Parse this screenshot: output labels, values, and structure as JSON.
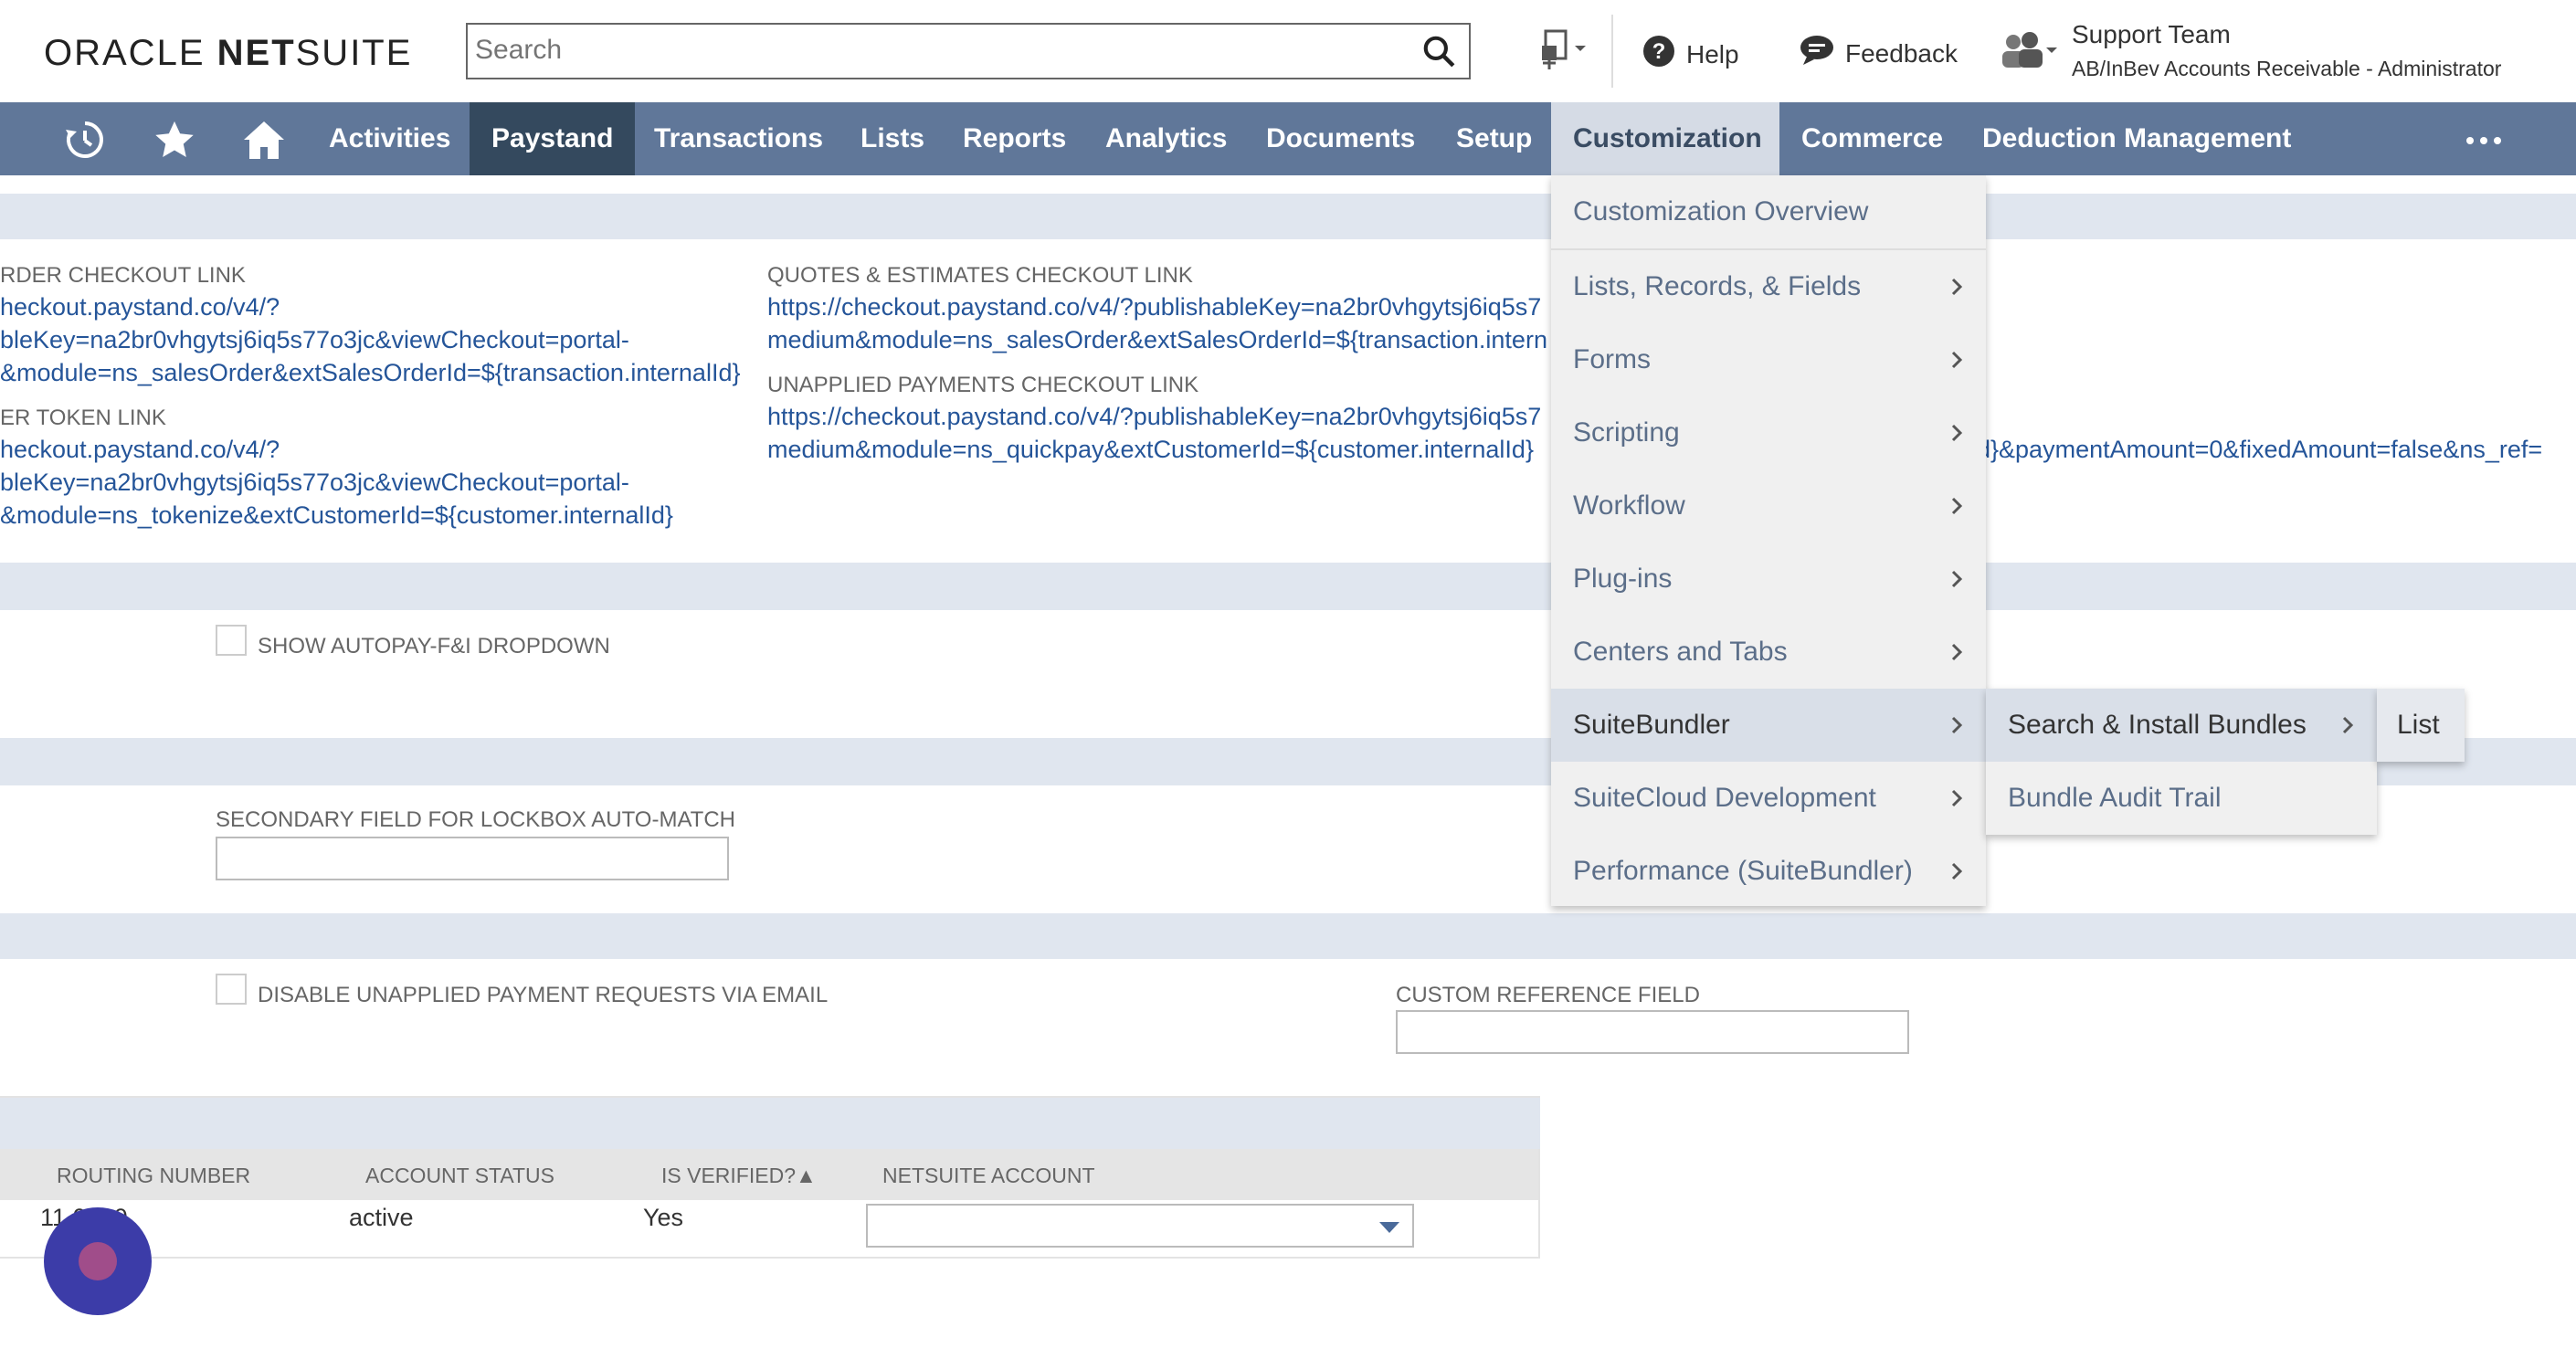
{
  "header": {
    "logo_oracle": "ORACLE",
    "logo_netsuite_bold": "NET",
    "logo_netsuite_rest": "SUITE",
    "search_placeholder": "Search",
    "help": "Help",
    "feedback": "Feedback",
    "role_name": "Support Team",
    "role_subtitle": "AB/InBev Accounts Receivable  -  Administrator"
  },
  "nav": {
    "items": [
      "Activities",
      "Paystand",
      "Transactions",
      "Lists",
      "Reports",
      "Analytics",
      "Documents",
      "Setup",
      "Customization",
      "Commerce",
      "Deduction Management"
    ]
  },
  "content": {
    "order_checkout_label": "RDER CHECKOUT LINK",
    "order_checkout_lines": [
      "heckout.paystand.co/v4/?",
      "bleKey=na2br0vhgytsj6iq5s77o3jc&viewCheckout=portal-",
      "&module=ns_salesOrder&extSalesOrderId=${transaction.internalId}"
    ],
    "token_label": "ER TOKEN LINK",
    "token_lines": [
      "heckout.paystand.co/v4/?",
      "bleKey=na2br0vhgytsj6iq5s77o3jc&viewCheckout=portal-",
      "&module=ns_tokenize&extCustomerId=${customer.internalId}"
    ],
    "quotes_label": "QUOTES & ESTIMATES CHECKOUT LINK",
    "quotes_lines": [
      "https://checkout.paystand.co/v4/?publishableKey=na2br0vhgytsj6iq5s7",
      "medium&module=ns_salesOrder&extSalesOrderId=${transaction.intern"
    ],
    "unapplied_label": "UNAPPLIED PAYMENTS CHECKOUT LINK",
    "unapplied_lines": [
      "https://checkout.paystand.co/v4/?publishableKey=na2br0vhgytsj6iq5s7",
      "medium&module=ns_quickpay&extCustomerId=${customer.internalId}"
    ],
    "unapplied_overflow": "d}&paymentAmount=0&fixedAmount=false&ns_ref=",
    "autopay_label": "SHOW AUTOPAY-F&I DROPDOWN",
    "lockbox_label": "SECONDARY FIELD FOR LOCKBOX AUTO-MATCH",
    "disable_label": "DISABLE UNAPPLIED PAYMENT REQUESTS VIA EMAIL",
    "custom_ref_label": "CUSTOM REFERENCE FIELD"
  },
  "table": {
    "headers": [
      "ROUTING NUMBER",
      "ACCOUNT STATUS",
      "IS VERIFIED?▲",
      "NETSUITE ACCOUNT"
    ],
    "row": {
      "routing": "11   0000",
      "status": "active",
      "verified": "Yes"
    }
  },
  "menu": {
    "overview": "Customization Overview",
    "items": [
      "Lists, Records, & Fields",
      "Forms",
      "Scripting",
      "Workflow",
      "Plug-ins",
      "Centers and Tabs",
      "SuiteBundler",
      "SuiteCloud Development",
      "Performance (SuiteBundler)"
    ],
    "sub_items": [
      "Search & Install Bundles",
      "Bundle Audit Trail"
    ],
    "sub_sub_items": [
      "List"
    ]
  },
  "colors": {
    "nav_bg": "#607799",
    "nav_active": "#34495e",
    "link": "#255599",
    "band": "#e0e6ef"
  }
}
